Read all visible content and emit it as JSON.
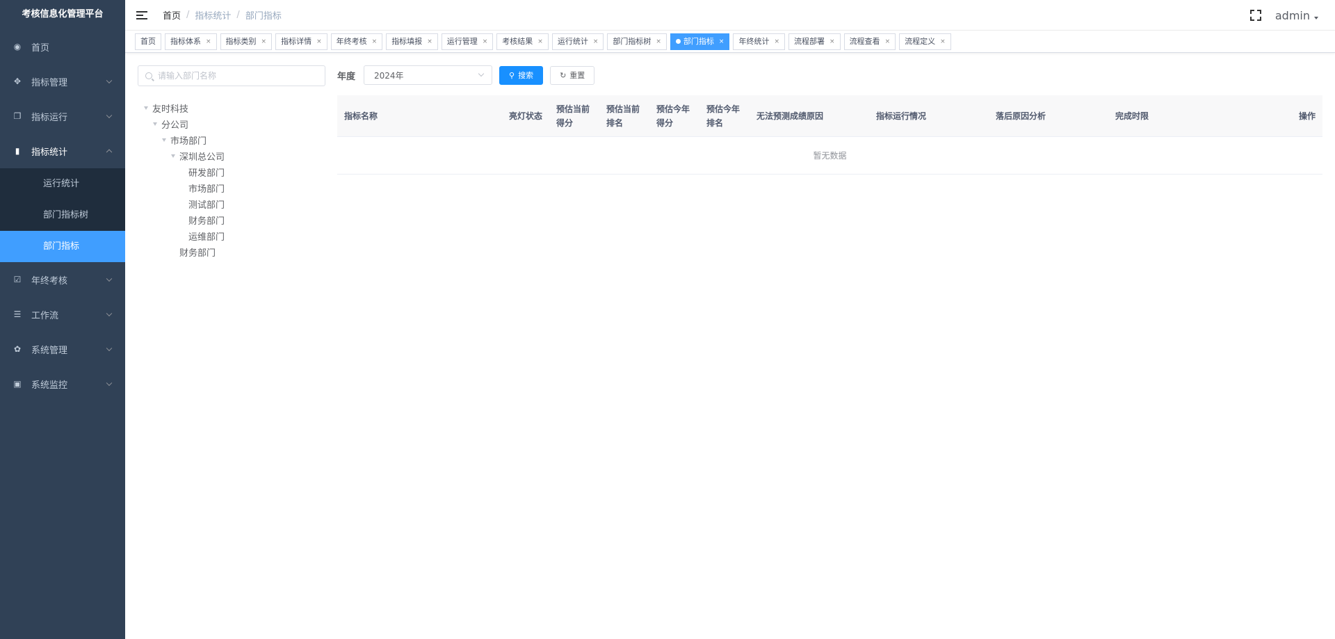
{
  "app": {
    "title": "考核信息化管理平台"
  },
  "sidebar": {
    "items": [
      {
        "label": "首页",
        "icon": "dashboard-icon",
        "glyph": "◉",
        "has_children": false
      },
      {
        "label": "指标管理",
        "icon": "move-icon",
        "glyph": "✥",
        "has_children": true
      },
      {
        "label": "指标运行",
        "icon": "copy-icon",
        "glyph": "❐",
        "has_children": true
      },
      {
        "label": "指标统计",
        "icon": "bar-chart-icon",
        "glyph": "▮",
        "has_children": true,
        "open": true,
        "children": [
          {
            "label": "运行统计"
          },
          {
            "label": "部门指标树"
          },
          {
            "label": "部门指标",
            "active": true
          }
        ]
      },
      {
        "label": "年终考核",
        "icon": "checkbox-icon",
        "glyph": "☑",
        "has_children": true
      },
      {
        "label": "工作流",
        "icon": "sliders-icon",
        "glyph": "☰",
        "has_children": true
      },
      {
        "label": "系统管理",
        "icon": "gear-icon",
        "glyph": "✿",
        "has_children": true
      },
      {
        "label": "系统监控",
        "icon": "monitor-icon",
        "glyph": "▣",
        "has_children": true
      }
    ]
  },
  "header": {
    "breadcrumb": {
      "home": "首页",
      "level1": "指标统计",
      "level2": "部门指标",
      "separator": "/"
    },
    "user": "admin"
  },
  "tags": [
    {
      "label": "首页",
      "closable": false
    },
    {
      "label": "指标体系",
      "closable": true
    },
    {
      "label": "指标类别",
      "closable": true
    },
    {
      "label": "指标详情",
      "closable": true
    },
    {
      "label": "年终考核",
      "closable": true
    },
    {
      "label": "指标填报",
      "closable": true
    },
    {
      "label": "运行管理",
      "closable": true
    },
    {
      "label": "考核结果",
      "closable": true
    },
    {
      "label": "运行统计",
      "closable": true
    },
    {
      "label": "部门指标树",
      "closable": true
    },
    {
      "label": "部门指标",
      "closable": true,
      "active": true
    },
    {
      "label": "年终统计",
      "closable": true
    },
    {
      "label": "流程部署",
      "closable": true
    },
    {
      "label": "流程查看",
      "closable": true
    },
    {
      "label": "流程定义",
      "closable": true
    }
  ],
  "tree": {
    "search_placeholder": "请输入部门名称",
    "nodes": [
      {
        "label": "友时科技",
        "depth": 0,
        "expandable": true
      },
      {
        "label": "分公司",
        "depth": 1,
        "expandable": true
      },
      {
        "label": "市场部门",
        "depth": 2,
        "expandable": true
      },
      {
        "label": "深圳总公司",
        "depth": 3,
        "expandable": true
      },
      {
        "label": "研发部门",
        "depth": 4,
        "expandable": false
      },
      {
        "label": "市场部门",
        "depth": 4,
        "expandable": false
      },
      {
        "label": "测试部门",
        "depth": 4,
        "expandable": false
      },
      {
        "label": "财务部门",
        "depth": 4,
        "expandable": false
      },
      {
        "label": "运维部门",
        "depth": 4,
        "expandable": false
      },
      {
        "label": "财务部门",
        "depth": 3,
        "expandable": false
      }
    ]
  },
  "filter": {
    "year_label": "年度",
    "year_value": "2024年",
    "search_button": "搜索",
    "reset_button": "重置"
  },
  "table": {
    "columns": [
      {
        "label": "指标名称",
        "align": "left"
      },
      {
        "label": "亮灯状态",
        "align": "right"
      },
      {
        "label": "预估当前得分",
        "align": "left"
      },
      {
        "label": "预估当前排名",
        "align": "left"
      },
      {
        "label": "预估今年得分",
        "align": "left"
      },
      {
        "label": "预估今年排名",
        "align": "left"
      },
      {
        "label": "无法预测成绩原因",
        "align": "left"
      },
      {
        "label": "指标运行情况",
        "align": "left"
      },
      {
        "label": "落后原因分析",
        "align": "left"
      },
      {
        "label": "完成时限",
        "align": "left"
      },
      {
        "label": "操作",
        "align": "right"
      }
    ],
    "empty_text": "暂无数据"
  },
  "colors": {
    "sidebar_bg": "#304156",
    "submenu_bg": "#1f2d3d",
    "accent": "#409eff",
    "primary_button": "#1890ff"
  }
}
